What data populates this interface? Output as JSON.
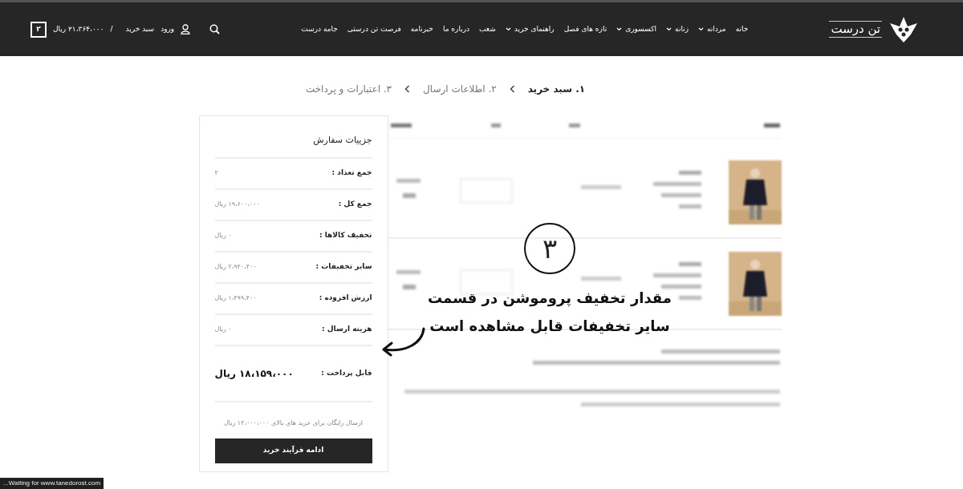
{
  "header": {
    "logo_text": "تن درست",
    "nav": [
      {
        "label": "خانه",
        "has_dropdown": false
      },
      {
        "label": "مردانه",
        "has_dropdown": true
      },
      {
        "label": "زنانه",
        "has_dropdown": true
      },
      {
        "label": "اکسسوری",
        "has_dropdown": true
      },
      {
        "label": "تازه های فصل",
        "has_dropdown": false
      },
      {
        "label": "راهنمای خرید",
        "has_dropdown": true
      },
      {
        "label": "شعب",
        "has_dropdown": false
      },
      {
        "label": "درباره ما",
        "has_dropdown": false
      },
      {
        "label": "خبرنامه",
        "has_dropdown": false
      },
      {
        "label": "فرصت تن درستی",
        "has_dropdown": false
      },
      {
        "label": "جامه درست",
        "has_dropdown": false
      }
    ],
    "login": "ورود",
    "cart_label": "سبد خرید",
    "separator": "/",
    "cart_total": "۲۱،۳۶۴،۰۰۰ ریال",
    "cart_count": "۲"
  },
  "steps": [
    {
      "label": "۱. سبد خرید",
      "selected": true
    },
    {
      "label": "۲. اطلاعات ارسال",
      "selected": false
    },
    {
      "label": "۳. اعتبارات و پرداخت",
      "selected": false
    }
  ],
  "order_summary": {
    "title": "جزییات سفارش",
    "rows": [
      {
        "label": "جمع تعداد :",
        "value": "۲"
      },
      {
        "label": "جمع کل :",
        "value": "۱۹،۶۰۰،۰۰۰ ریال"
      },
      {
        "label": "تخفیف کالاها :",
        "value": "۰ ریال"
      },
      {
        "label": "سایر تخفیفات :",
        "value": "۲،۹۴۰،۴۰۰ ریال"
      },
      {
        "label": "ارزش افزوده :",
        "value": "۱،۴۹۹،۴۰۰ ریال"
      },
      {
        "label": "هزینه ارسال :",
        "value": "۰ ریال"
      }
    ],
    "payable_label": "قابل پرداخت :",
    "payable_value": "۱۸،۱۵۹،۰۰۰ ریال",
    "free_shipping_note": "ارسال رایگان برای خرید های بالای ۱۲،۰۰۰،۰۰۰ ریال",
    "continue_button": "ادامه فرآیند خرید"
  },
  "annotation": {
    "number": "۳",
    "lines": [
      "مقدار تخفیف پروموشن در قسمت",
      "سایر تخفیفات قابل مشاهده است"
    ]
  },
  "status_bar": "Waiting for www.tanedorost.com..."
}
